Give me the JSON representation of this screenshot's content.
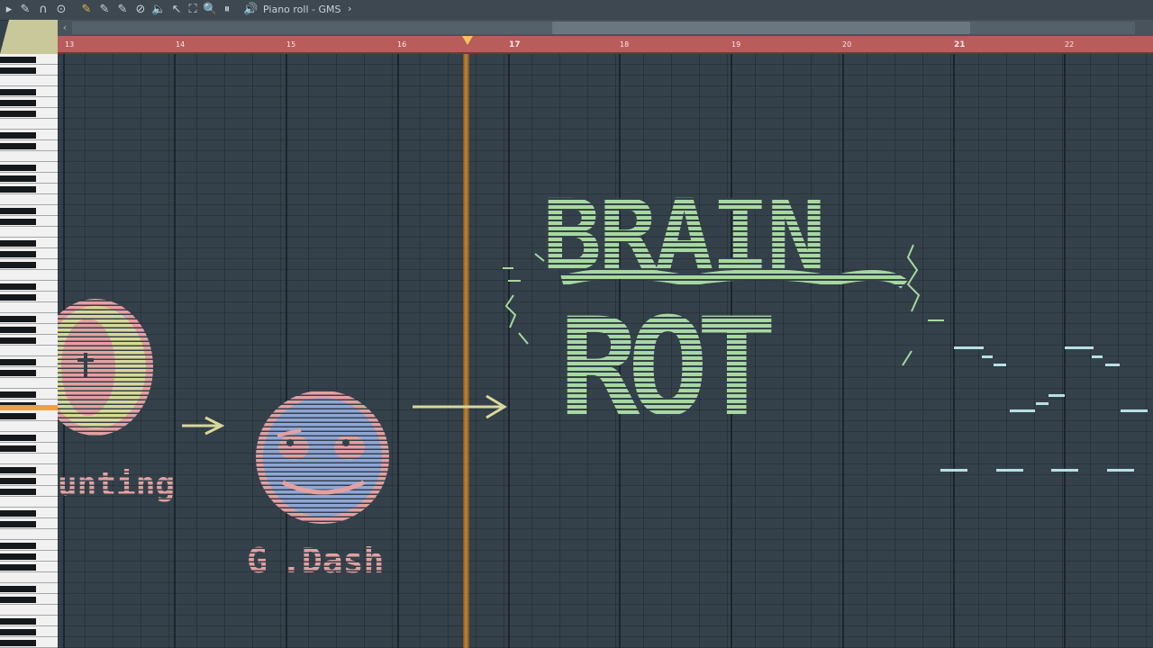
{
  "toolbar": {
    "title": "Piano roll - GMS",
    "chevron": "›",
    "icons": [
      "▸",
      "✎",
      "∩",
      "⊙",
      "✎",
      "✎",
      "✎",
      "⊘",
      "🔈",
      "↖",
      "⛶",
      "🔍",
      "⏸",
      "🔊"
    ]
  },
  "timeline": {
    "bars": [
      "13",
      "14",
      "15",
      "16",
      "17",
      "18",
      "19",
      "20",
      "21",
      "22"
    ]
  },
  "art": {
    "brain": "BRAIN",
    "rot": "ROT",
    "counting": "unting",
    "gdash": "G.Dash",
    "gdash_left": "G",
    "gdash_right": ".Dash"
  },
  "colors": {
    "grid": "#34414a",
    "timeline": "#b85c5c",
    "playhead": "#d4841e",
    "green_notes": "#a7d8a0",
    "pink_notes": "#e4a0a0",
    "blue_notes": "#8fa6d8",
    "yellow_notes": "#d8d89a",
    "cyan_notes": "#b7e0e6"
  }
}
